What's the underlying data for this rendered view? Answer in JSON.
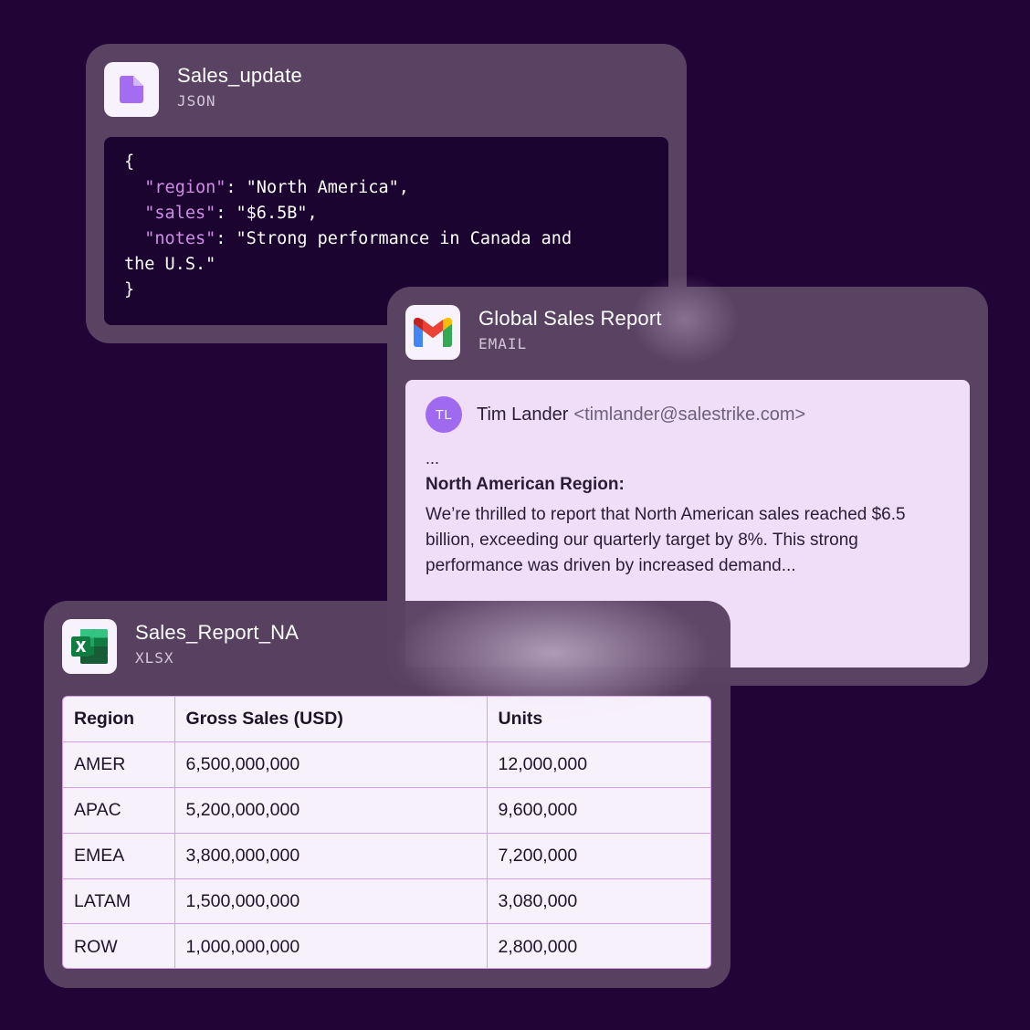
{
  "json_card": {
    "title": "Sales_update",
    "type": "JSON",
    "icon": "file-icon",
    "code": {
      "open": "{",
      "region_key": "\"region\"",
      "region_val": ": \"North America\",",
      "sales_key": "\"sales\"",
      "sales_val": ": \"$6.5B\",",
      "notes_key": "\"notes\"",
      "notes_val": ": \"Strong performance in Canada and",
      "notes_cont": "the U.S.\"",
      "close": "}"
    }
  },
  "email_card": {
    "title": "Global Sales Report",
    "type": "EMAIL",
    "icon": "gmail-icon",
    "sender_initials": "TL",
    "sender_name": "Tim Lander",
    "sender_email": "<timlander@salestrike.com>",
    "ellipsis": "...",
    "heading": "North American Region:",
    "body": "We’re thrilled to report that North American sales reached $6.5 billion, exceeding our quarterly target by 8%. This strong performance was driven by increased demand..."
  },
  "xlsx_card": {
    "title": "Sales_Report_NA",
    "type": "XLSX",
    "icon": "excel-icon",
    "columns": [
      "Region",
      "Gross Sales (USD)",
      "Units"
    ],
    "rows": [
      [
        "AMER",
        "6,500,000,000",
        "12,000,000"
      ],
      [
        "APAC",
        "5,200,000,000",
        "9,600,000"
      ],
      [
        "EMEA",
        "3,800,000,000",
        "7,200,000"
      ],
      [
        "LATAM",
        "1,500,000,000",
        "3,080,000"
      ],
      [
        "ROW",
        "1,000,000,000",
        "2,800,000"
      ]
    ]
  },
  "colors": {
    "background": "#220436",
    "card": "#5a4263",
    "code_bg": "#1c0430",
    "code_key": "#cf8de6",
    "email_body": "#f0def9",
    "avatar": "#9f6af0",
    "table_border": "#d59ee8"
  }
}
